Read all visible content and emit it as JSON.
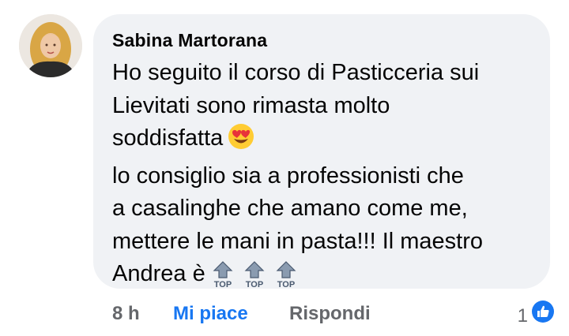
{
  "comment": {
    "author": "Sabina Martorana",
    "lines": [
      "Ho seguito il corso di Pasticceria sui",
      "Lievitati sono rimasta molto",
      "soddisfatta",
      " lo consiglio sia a professionisti che",
      "a casalinghe che amano come me,",
      "mettere le mani in pasta!!! Il maestro",
      "Andrea è"
    ],
    "emoji": "smiling-face-with-heart-eyes",
    "top_icons": [
      "TOP",
      "TOP",
      "TOP"
    ]
  },
  "actions": {
    "time": "8 h",
    "like_label": "Mi piace",
    "reply_label": "Rispondi",
    "reaction_count": "1"
  },
  "colors": {
    "bubble": "#f0f2f5",
    "like_blue": "#1877f2",
    "meta_gray": "#65676b",
    "text": "#050505"
  }
}
